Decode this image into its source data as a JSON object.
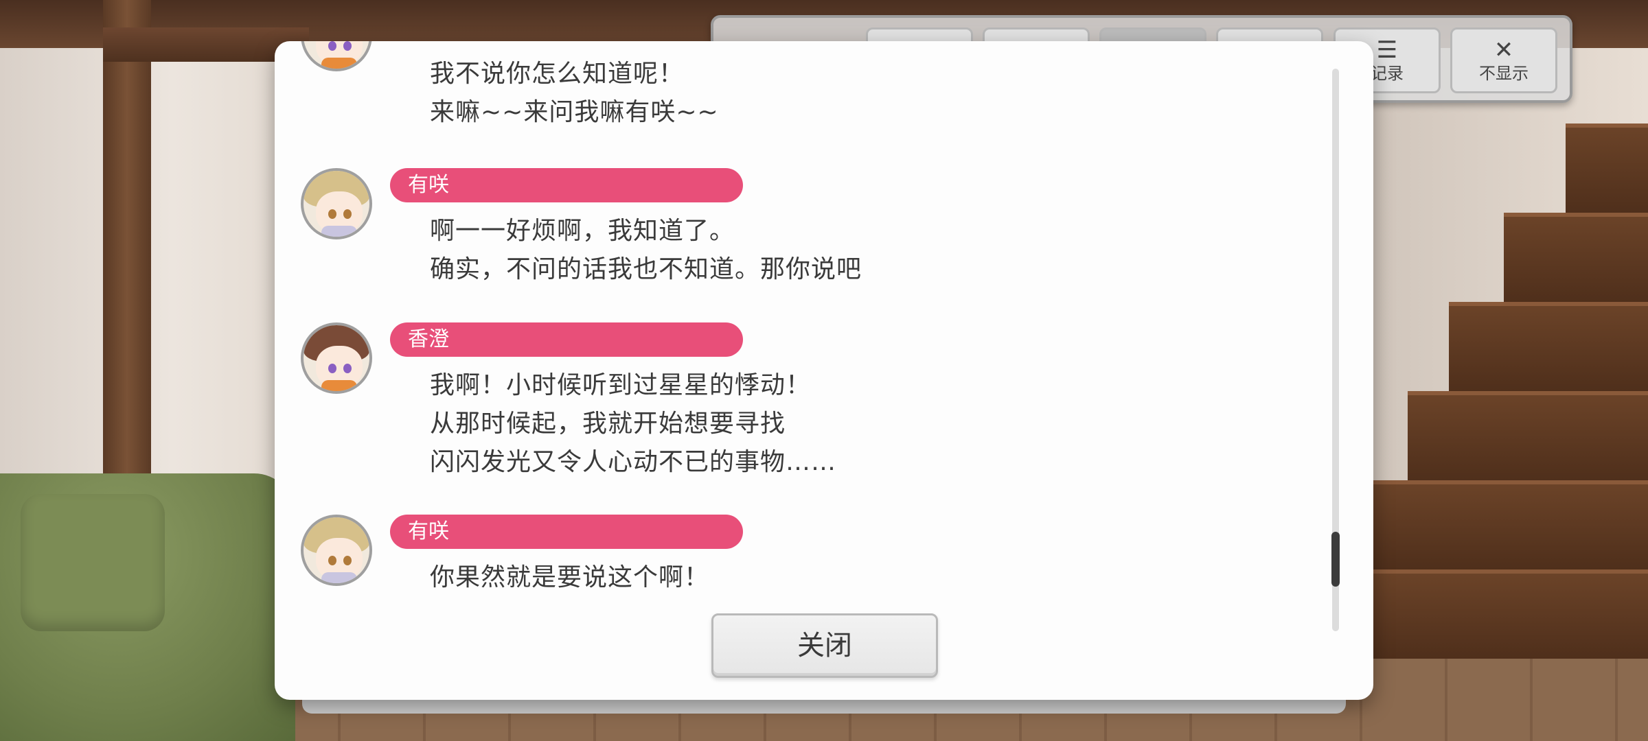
{
  "toolbar": {
    "buttons": [
      {
        "icon": "skip-back-icon",
        "glyph": "⏮",
        "label": ""
      },
      {
        "icon": "play-icon",
        "glyph": "▶",
        "label": ""
      },
      {
        "icon": "auto-icon",
        "glyph": "[ ]",
        "label": ""
      },
      {
        "icon": "skip-forward-icon",
        "glyph": "⏭",
        "label": ""
      },
      {
        "icon": "log-icon",
        "glyph": "☰",
        "label": "记录"
      },
      {
        "icon": "close-icon",
        "glyph": "✕",
        "label": "不显示"
      }
    ]
  },
  "log": {
    "entries": [
      {
        "speaker": "",
        "avatar": "kasumi",
        "lines": [
          "我不说你怎么知道呢！",
          "来嘛~~来问我嘛有咲~~"
        ]
      },
      {
        "speaker": "有咲",
        "avatar": "arisa",
        "lines": [
          "啊一一好烦啊，我知道了。",
          "确实，不问的话我也不知道。那你说吧"
        ]
      },
      {
        "speaker": "香澄",
        "avatar": "kasumi",
        "lines": [
          "我啊！小时候听到过星星的悸动！",
          "从那时候起，我就开始想要寻找",
          "闪闪发光又令人心动不已的事物……"
        ]
      },
      {
        "speaker": "有咲",
        "avatar": "arisa",
        "lines": [
          "你果然就是要说这个啊！"
        ]
      }
    ]
  },
  "dialog": {
    "close_label": "关闭"
  },
  "colors": {
    "name_bar": "#e84f79",
    "dialog_bg": "#fdfdfd",
    "text": "#3a3a3a"
  }
}
